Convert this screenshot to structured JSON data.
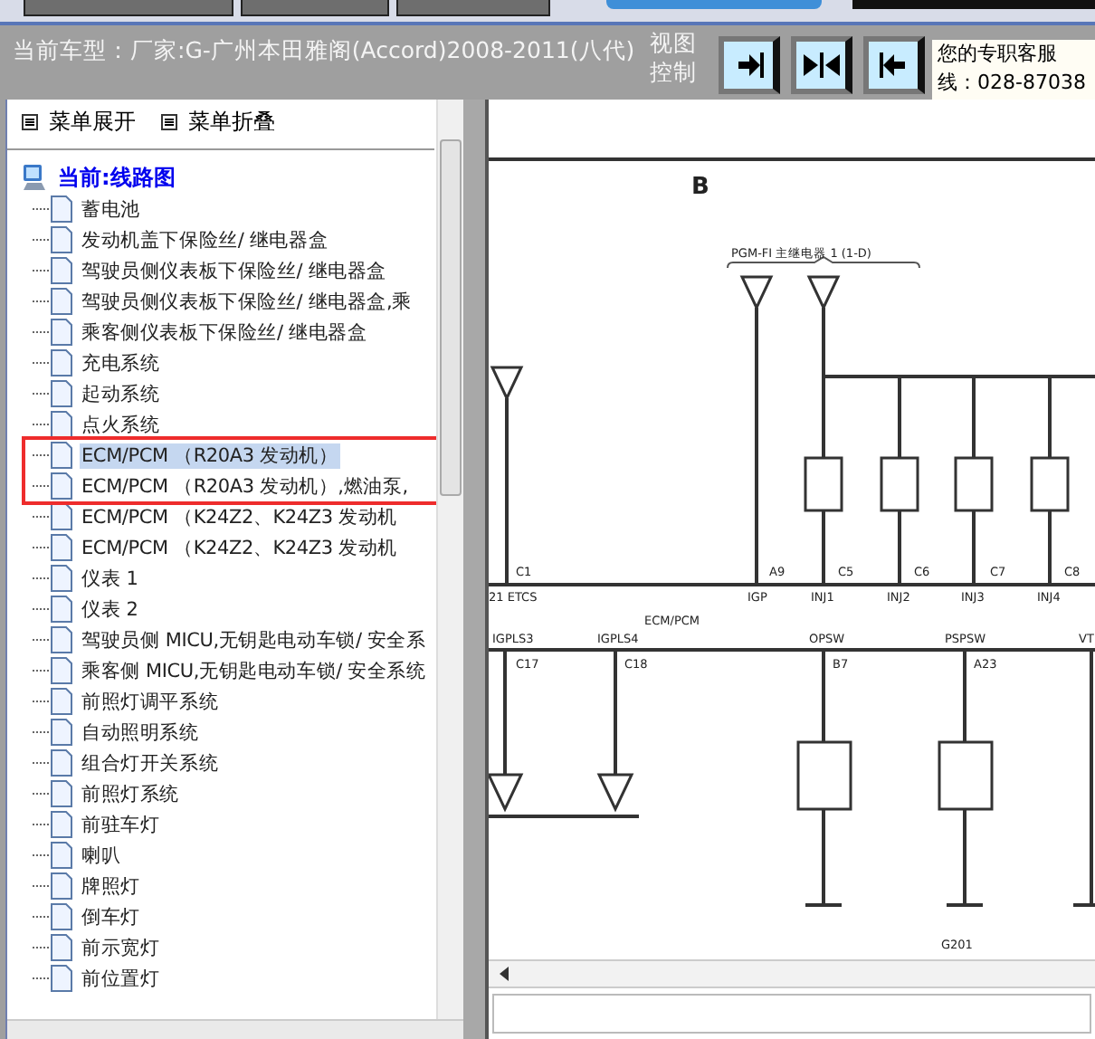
{
  "header": {
    "car_model": "当前车型：厂家:G-广州本田雅阁(Accord)2008-2011(八代)",
    "view_control": [
      "视图",
      "控制"
    ],
    "nav_buttons": [
      {
        "kind": "right"
      },
      {
        "kind": "both"
      },
      {
        "kind": "left"
      }
    ],
    "service": {
      "line_1": "您的专职客服",
      "line_2": "线：028-87038"
    }
  },
  "sidebar": {
    "menu_buttons": [
      {
        "label": "菜单展开"
      },
      {
        "label": "菜单折叠"
      }
    ],
    "tree": {
      "label": "当前:线路图",
      "children": [
        {
          "label": "蓄电池",
          "selected": false,
          "marked": false
        },
        {
          "label": "发动机盖下保险丝/ 继电器盒",
          "selected": false,
          "marked": false
        },
        {
          "label": "驾驶员侧仪表板下保险丝/ 继电器盒",
          "selected": false,
          "marked": false
        },
        {
          "label": "驾驶员侧仪表板下保险丝/ 继电器盒,乘",
          "selected": false,
          "marked": false
        },
        {
          "label": "乘客侧仪表板下保险丝/ 继电器盒",
          "selected": false,
          "marked": false
        },
        {
          "label": "充电系统",
          "selected": false,
          "marked": false
        },
        {
          "label": "起动系统",
          "selected": false,
          "marked": false
        },
        {
          "label": "点火系统",
          "selected": false,
          "marked": false
        },
        {
          "label": "ECM/PCM （R20A3 发动机）",
          "selected": true,
          "marked": true
        },
        {
          "label": "ECM/PCM （R20A3 发动机）,燃油泵,",
          "selected": false,
          "marked": true
        },
        {
          "label": "ECM/PCM （K24Z2、K24Z3 发动机",
          "selected": false,
          "marked": false
        },
        {
          "label": "ECM/PCM （K24Z2、K24Z3 发动机",
          "selected": false,
          "marked": false
        },
        {
          "label": "仪表 1",
          "selected": false,
          "marked": false
        },
        {
          "label": "仪表 2",
          "selected": false,
          "marked": false
        },
        {
          "label": "驾驶员侧 MICU,无钥匙电动车锁/ 安全系",
          "selected": false,
          "marked": false
        },
        {
          "label": "乘客侧 MICU,无钥匙电动车锁/ 安全系统",
          "selected": false,
          "marked": false
        },
        {
          "label": "前照灯调平系统",
          "selected": false,
          "marked": false
        },
        {
          "label": "自动照明系统",
          "selected": false,
          "marked": false
        },
        {
          "label": "组合灯开关系统",
          "selected": false,
          "marked": false
        },
        {
          "label": "前照灯系统",
          "selected": false,
          "marked": false
        },
        {
          "label": "前驻车灯",
          "selected": false,
          "marked": false
        },
        {
          "label": "喇叭",
          "selected": false,
          "marked": false
        },
        {
          "label": "牌照灯",
          "selected": false,
          "marked": false
        },
        {
          "label": "倒车灯",
          "selected": false,
          "marked": false
        },
        {
          "label": "前示宽灯",
          "selected": false,
          "marked": false
        },
        {
          "label": "前位置灯",
          "selected": false,
          "marked": false
        }
      ]
    }
  },
  "diagram": {
    "title": "B",
    "relay_label": "PGM-FI 主继电器 1 (1-D)",
    "unit": "ECM/PCM",
    "upper_connectors": [
      "C1",
      "A9",
      "C5",
      "C6",
      "C7",
      "C8"
    ],
    "upper_pins": [
      "21 ETCS",
      "IGP",
      "INJ1",
      "INJ2",
      "INJ3",
      "INJ4"
    ],
    "lower_pins": [
      "IGPLS3",
      "IGPLS4",
      "OPSW",
      "PSPSW",
      "VT"
    ],
    "lower_connectors": [
      "C17",
      "C18",
      "B7",
      "A23"
    ],
    "ground": "G201"
  }
}
